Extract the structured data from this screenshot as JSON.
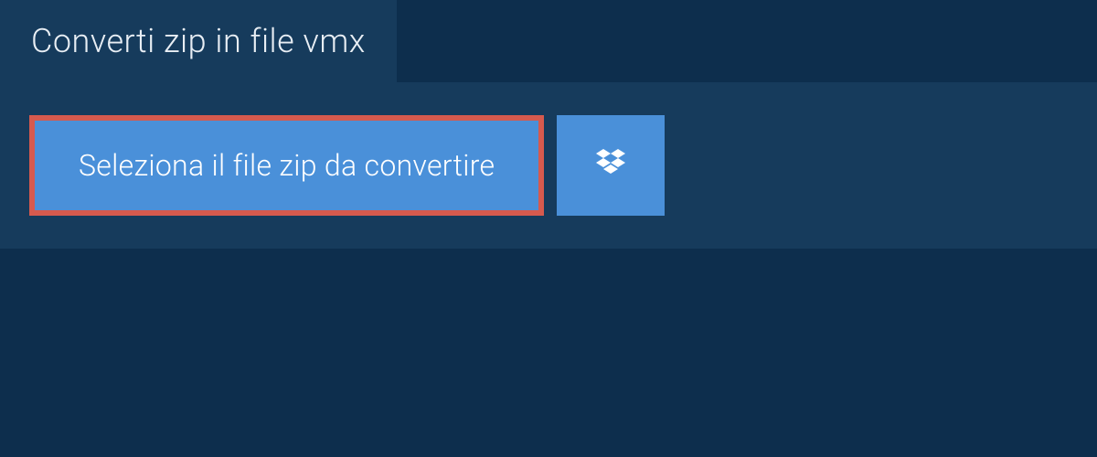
{
  "header": {
    "title": "Converti zip in file vmx"
  },
  "actions": {
    "select_file_label": "Seleziona il file zip da convertire"
  }
}
